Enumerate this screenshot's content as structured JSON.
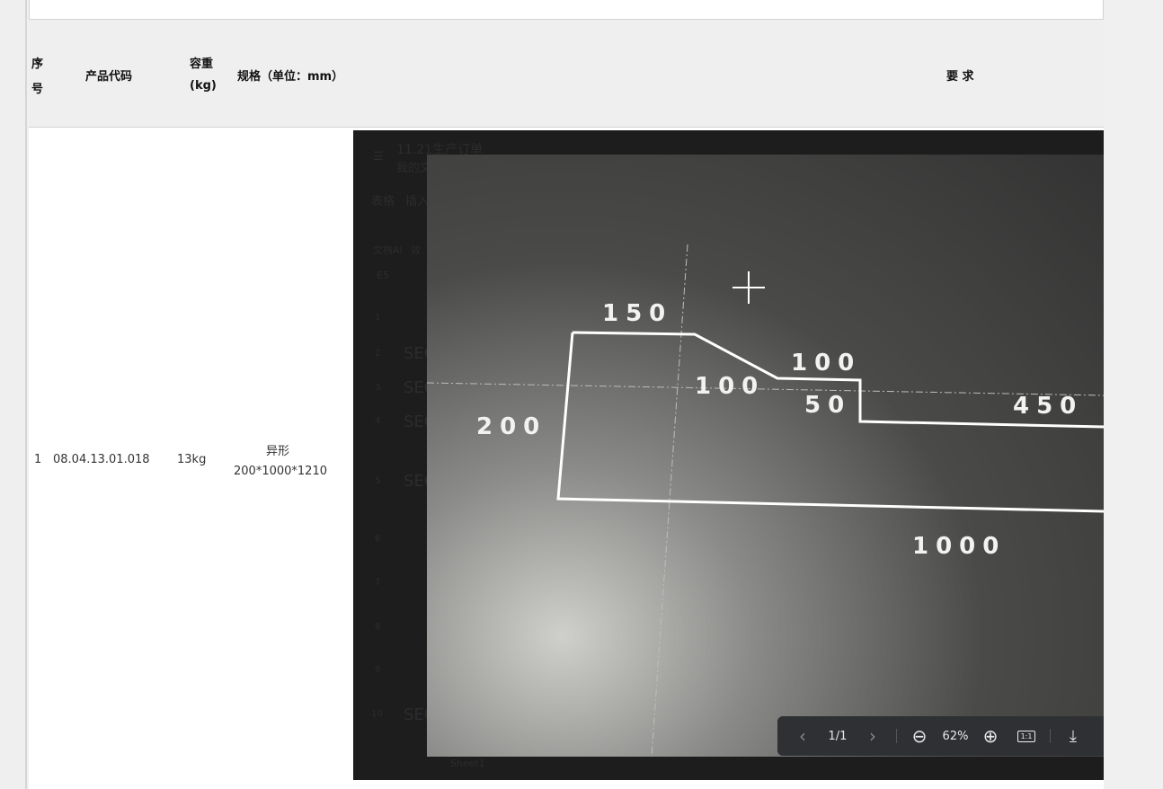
{
  "table": {
    "headers": {
      "index_line1": "序",
      "index_line2": "号",
      "product_code": "产品代码",
      "weight_line1": "容重",
      "weight_line2": "(kg)",
      "spec": "规格（单位：mm）",
      "requirements": "要 求"
    },
    "rows": [
      {
        "index": "1",
        "product_code": "08.04.13.01.018",
        "weight": "13kg",
        "spec_shape": "异形",
        "spec_size": "200*1000*1210"
      }
    ]
  },
  "background_app": {
    "doc_title": "11.21生产订单",
    "breadcrumb": "我的文",
    "menu": [
      "表格",
      "插入"
    ],
    "ai_label": "文档AI",
    "effect_label": "效",
    "cell_ref": "E5",
    "row_numbers": [
      "1",
      "2",
      "3",
      "4",
      "5",
      "6",
      "7",
      "8",
      "9",
      "10"
    ],
    "cell_text": "SEC",
    "sheet_tab": "Sheet1"
  },
  "photo": {
    "dimensions": [
      "150",
      "100",
      "100",
      "50",
      "450",
      "200",
      "1000"
    ]
  },
  "viewer": {
    "page": "1/1",
    "zoom": "62%"
  }
}
